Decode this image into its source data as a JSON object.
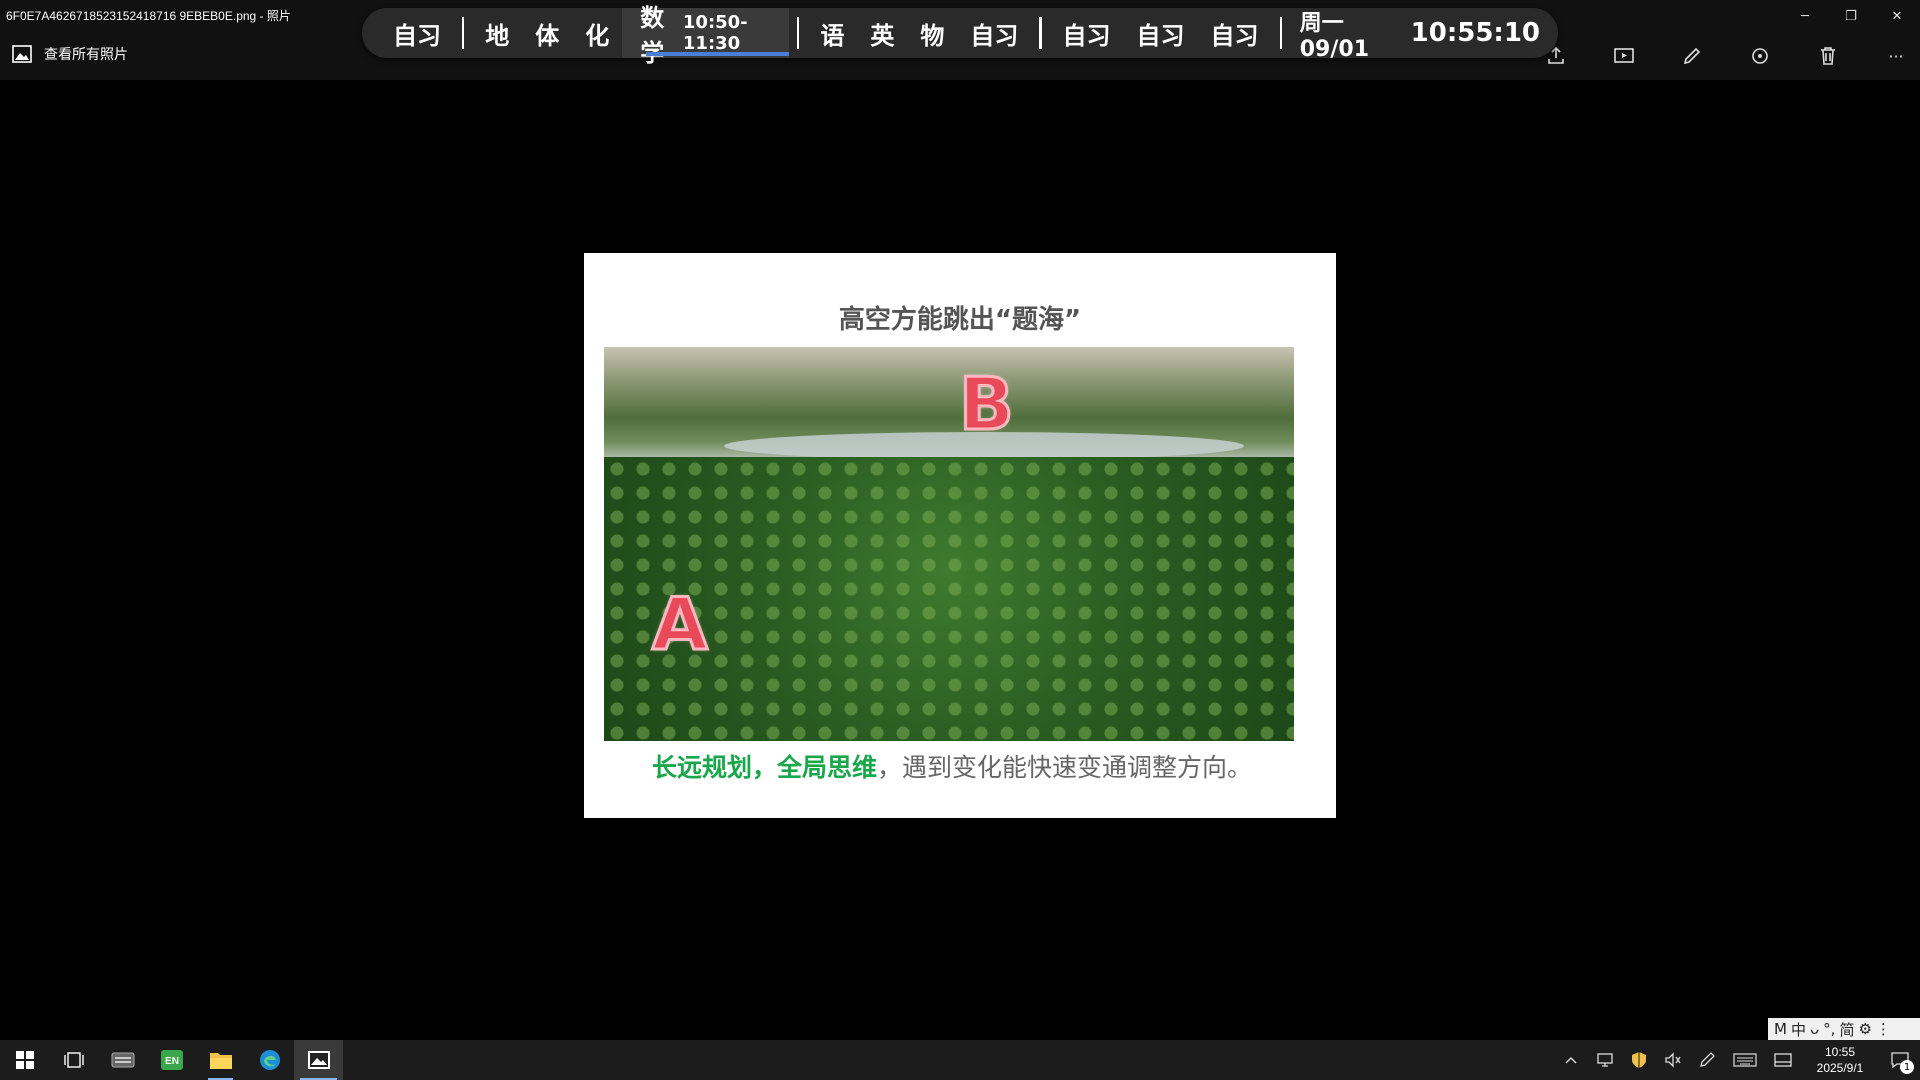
{
  "window": {
    "title": "6F0E7A4626718523152418716 9EBEB0E.png - 照片",
    "controls": {
      "minimize": "─",
      "restore": "❐",
      "close": "✕"
    }
  },
  "appbar": {
    "all_photos_label": "查看所有照片",
    "tools": [
      "share-icon",
      "slideshow-icon",
      "edit-icon",
      "rotate-icon",
      "delete-icon",
      "more-icon"
    ],
    "more_glyph": "···"
  },
  "schedule": {
    "items_group1": [
      "自习"
    ],
    "items_group2": [
      "地",
      "体",
      "化"
    ],
    "active": {
      "name": "数学",
      "time": "10:50-11:30"
    },
    "items_group3": [
      "语",
      "英",
      "物",
      "自习"
    ],
    "items_group4": [
      "自习",
      "自习",
      "自习"
    ],
    "date": "周一 09/01",
    "clock": "10:55:10",
    "accent_color": "#4a7fd8"
  },
  "slide": {
    "title": "高空方能跳出“题海”",
    "marker_a": "A",
    "marker_b": "B",
    "caption_green": "长远规划，全局思维",
    "caption_rest": "，遇到变化能快速变通调整方向。",
    "green_color": "#1aa64a"
  },
  "ime": {
    "items": [
      "M",
      "中",
      "ᴗ",
      "°,",
      "简",
      "⚙",
      "⋮"
    ]
  },
  "taskbar": {
    "apps": [
      "start-icon",
      "task-view-icon",
      "keyboard-app-icon",
      "en-app-icon",
      "file-explorer-icon",
      "edge-icon",
      "photos-icon"
    ],
    "tray": [
      "chevron-up-icon",
      "network-icon",
      "security-icon",
      "mute-icon",
      "pen-icon",
      "keyboard-icon",
      "tablet-icon"
    ],
    "time": "10:55",
    "date": "2025/9/1",
    "notification_count": "1"
  }
}
